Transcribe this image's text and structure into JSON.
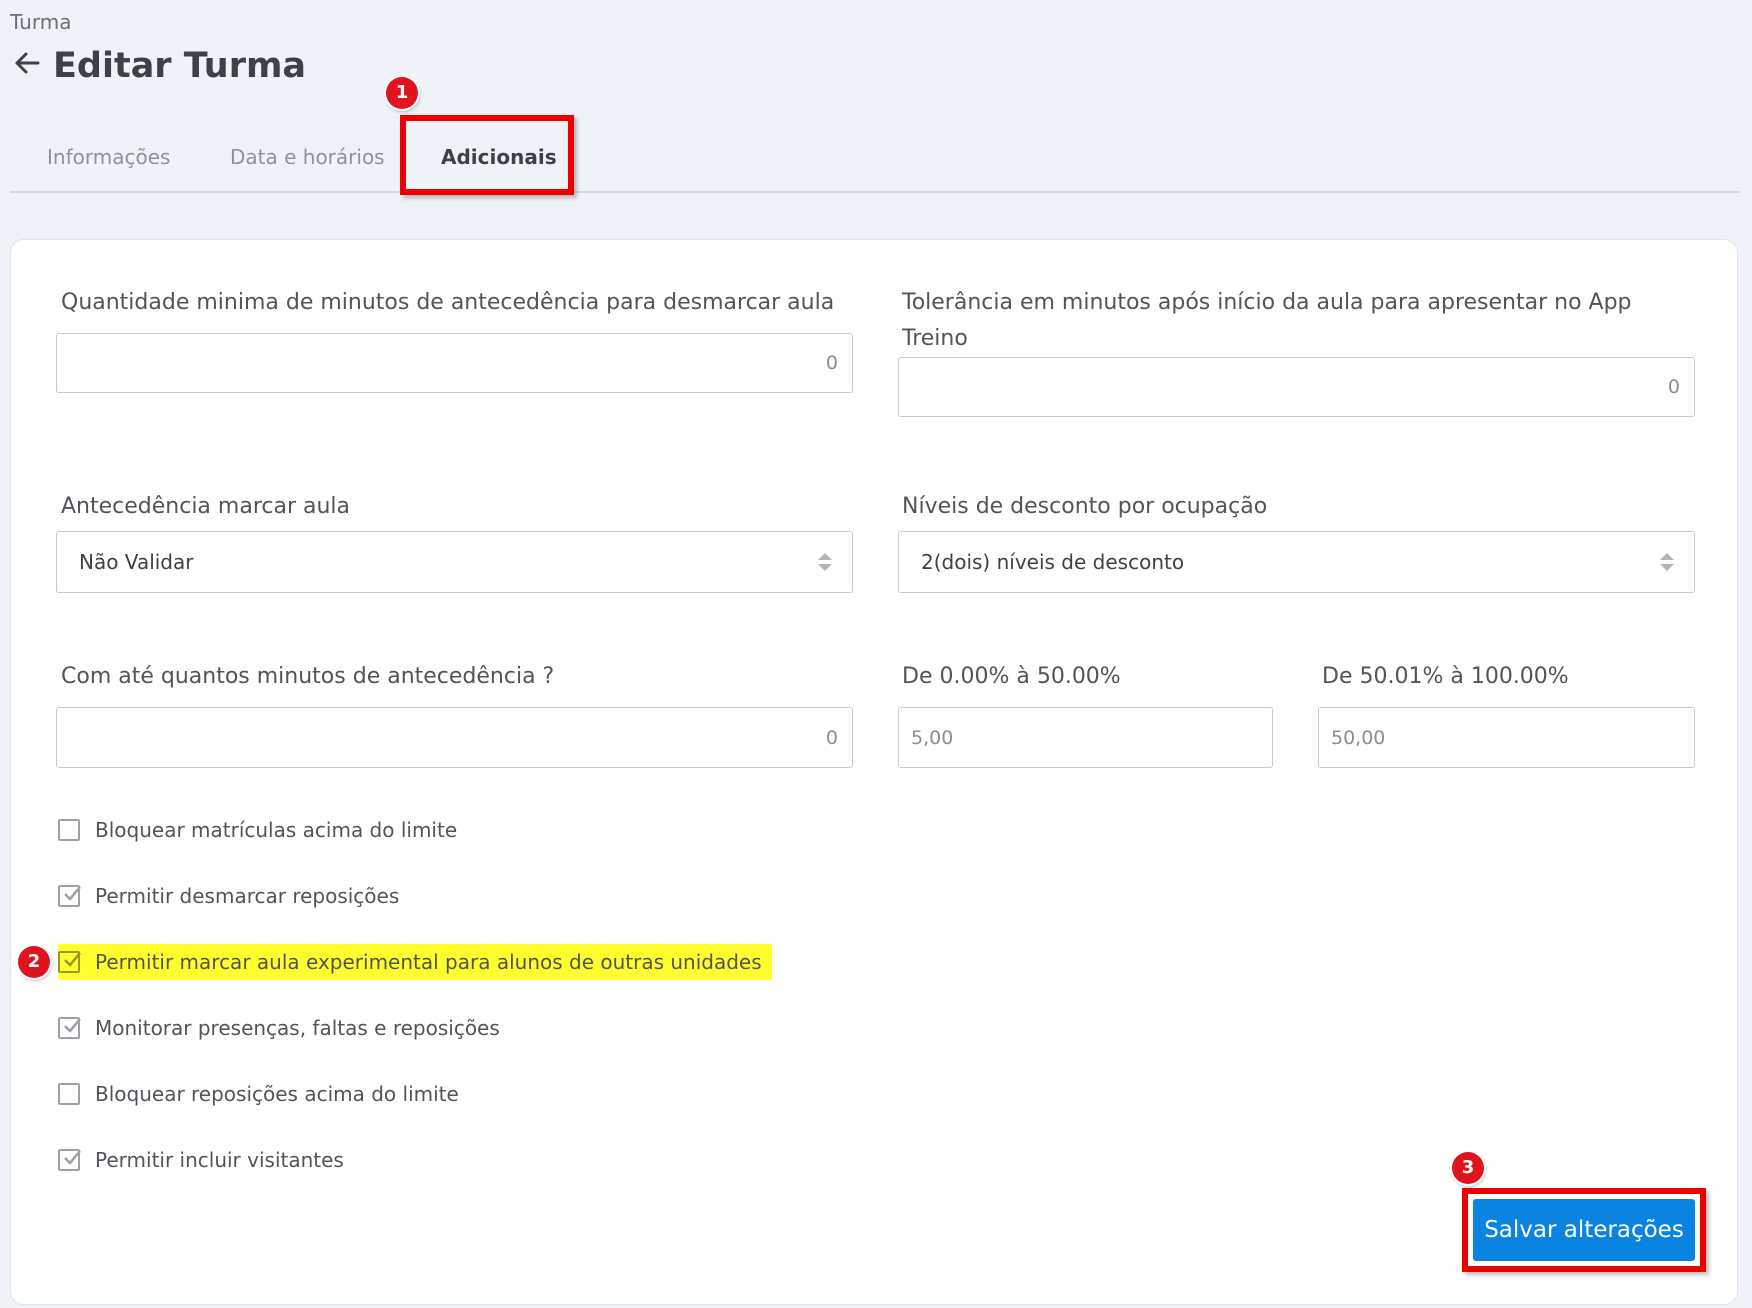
{
  "breadcrumb": "Turma",
  "page_title": "Editar Turma",
  "tabs": [
    {
      "label": "Informações"
    },
    {
      "label": "Data e horários"
    },
    {
      "label": "Adicionais"
    }
  ],
  "badges": [
    "1",
    "2",
    "3"
  ],
  "fields": {
    "min_minutes_cancel": {
      "label": "Quantidade minima de minutos de antecedência para desmarcar aula",
      "value": "0"
    },
    "tolerance": {
      "label_line1": "Tolerância em minutos após início da aula para apresentar no App",
      "label_line2": "Treino",
      "value": "0"
    },
    "advance_book": {
      "label": "Antecedência marcar aula",
      "selected": "Não Validar"
    },
    "discount_levels": {
      "label": "Níveis de desconto por ocupação",
      "selected": "2(dois) níveis de desconto"
    },
    "advance_minutes": {
      "label": "Com até quantos minutos de antecedência ?",
      "value": "0"
    },
    "level1": {
      "label": "De 0.00% à 50.00%",
      "placeholder": "5,00"
    },
    "level2": {
      "label": "De 50.01% à 100.00%",
      "placeholder": "50,00"
    }
  },
  "checkboxes": [
    {
      "label": "Bloquear matrículas acima do limite",
      "checked": false
    },
    {
      "label": "Permitir desmarcar reposições",
      "checked": true
    },
    {
      "label": "Permitir marcar aula experimental para alunos de outras unidades",
      "checked": true
    },
    {
      "label": "Monitorar presenças, faltas e reposições",
      "checked": true
    },
    {
      "label": "Bloquear reposições acima do limite",
      "checked": false
    },
    {
      "label": "Permitir incluir visitantes",
      "checked": true
    }
  ],
  "save_button": "Salvar alterações",
  "colors": {
    "accent": "#0a84e0",
    "annotation": "#ee0000",
    "highlight": "#ffff2e"
  }
}
